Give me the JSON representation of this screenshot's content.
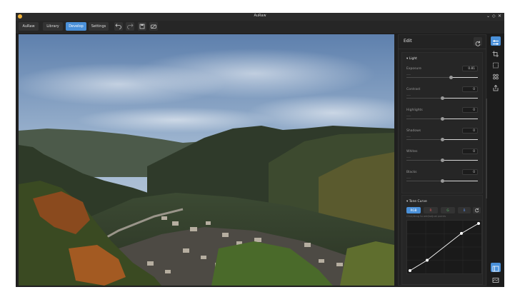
{
  "window": {
    "title": "AuRaw",
    "controls": [
      "⌄",
      "◇",
      "✕"
    ]
  },
  "tabs": [
    {
      "label": "AuRaw",
      "active": false
    },
    {
      "label": "Library",
      "active": false
    },
    {
      "label": "Develop",
      "active": true
    },
    {
      "label": "Settings",
      "active": false
    }
  ],
  "toolbar_icons": [
    "undo-icon",
    "redo-icon",
    "save-icon",
    "compare-icon"
  ],
  "panel": {
    "title": "Edit",
    "light": {
      "title": "Light",
      "sliders": [
        {
          "label": "Exposure",
          "value": "0.81",
          "level": 0.62
        },
        {
          "label": "Contrast",
          "value": "0",
          "level": 0.5
        },
        {
          "label": "Highlights",
          "value": "0",
          "level": 0.5
        },
        {
          "label": "Shadows",
          "value": "0",
          "level": 0.5
        },
        {
          "label": "Whites",
          "value": "0",
          "level": 0.5
        },
        {
          "label": "Blacks",
          "value": "0",
          "level": 0.5
        }
      ]
    },
    "tone_curve": {
      "title": "Tone Curve",
      "channels": [
        "RGB",
        "R",
        "G",
        "B"
      ],
      "active_channel": "RGB",
      "hint": "Click/drag to add/adjust points",
      "points": [
        [
          0,
          0
        ],
        [
          0.25,
          0.22
        ],
        [
          0.75,
          0.79
        ],
        [
          1,
          1
        ]
      ]
    }
  },
  "rail_icons": [
    {
      "name": "adjustments-icon",
      "active": true
    },
    {
      "name": "crop-icon",
      "active": false
    },
    {
      "name": "mask-icon",
      "active": false
    },
    {
      "name": "presets-icon",
      "active": false
    },
    {
      "name": "export-icon",
      "active": false
    }
  ],
  "rail_bottom_icons": [
    {
      "name": "panel-toggle-icon",
      "active": true
    },
    {
      "name": "filmstrip-icon",
      "active": false
    }
  ],
  "colors": {
    "accent": "#4a90d9",
    "app_icon": "#f0b23a"
  }
}
